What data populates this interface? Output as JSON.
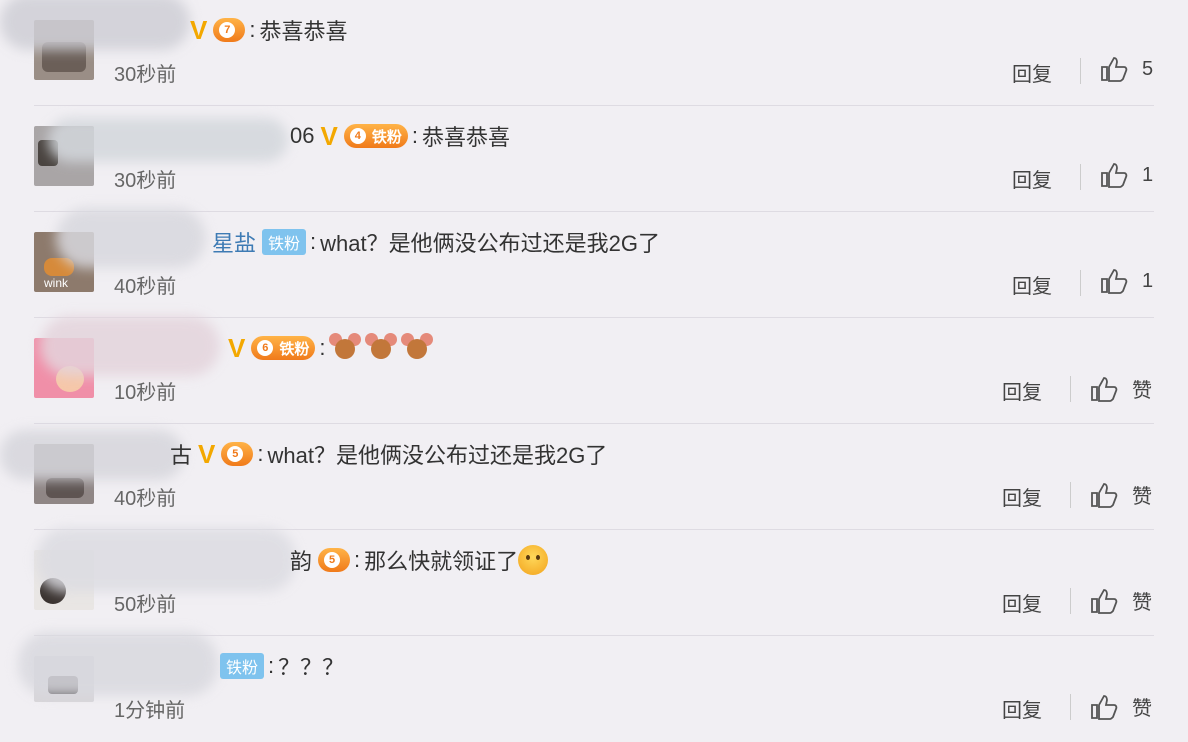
{
  "comments": [
    {
      "badge_level": "7",
      "badge_label": "",
      "tiefen": "",
      "username": "",
      "text": "恭喜恭喜",
      "time": "30秒前",
      "reply": "回复",
      "like": "5"
    },
    {
      "badge_level": "4",
      "badge_label": "铁粉",
      "tiefen": "",
      "username": "06",
      "text": "恭喜恭喜",
      "time": "30秒前",
      "reply": "回复",
      "like": "1"
    },
    {
      "badge_level": "",
      "badge_label": "",
      "tiefen": "铁粉",
      "username": "星盐",
      "text": "what？是他俩没公布过还是我2G了",
      "time": "40秒前",
      "reply": "回复",
      "like": "1"
    },
    {
      "badge_level": "6",
      "badge_label": "铁粉",
      "tiefen": "",
      "username": "",
      "text": "",
      "time": "10秒前",
      "reply": "回复",
      "like": "赞"
    },
    {
      "badge_level": "5",
      "badge_label": "",
      "tiefen": "",
      "username": "古",
      "text": "what？是他俩没公布过还是我2G了",
      "time": "40秒前",
      "reply": "回复",
      "like": "赞"
    },
    {
      "badge_level": "5",
      "badge_label": "",
      "tiefen": "",
      "username": "韵",
      "text": "那么快就领证了",
      "time": "50秒前",
      "reply": "回复",
      "like": "赞"
    },
    {
      "badge_level": "",
      "badge_label": "",
      "tiefen": "铁粉",
      "username": "",
      "text": "？？？",
      "time": "1分钟前",
      "reply": "回复",
      "like": "赞"
    }
  ],
  "avatar_watermark": "wink",
  "colors": {
    "background": "#f1eff3",
    "v_badge": "#f3a800",
    "tiefen": "#7fc3ee",
    "crown": "#f07a1a"
  },
  "icons": {
    "like": "thumbs-up-icon",
    "verified": "v-badge-icon",
    "fan_badge": "crown-badge-icon",
    "emoji_jerry": "jerry-mouse-emoji",
    "emoji_doge": "doge-emoji"
  }
}
